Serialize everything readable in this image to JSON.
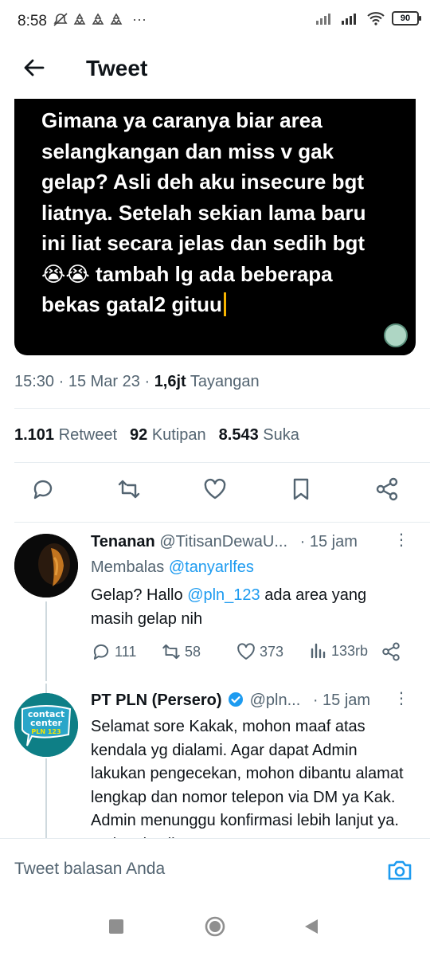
{
  "status_bar": {
    "time": "8:58",
    "battery": "90",
    "more": "···"
  },
  "header": {
    "title": "Tweet"
  },
  "tweet": {
    "image_text_lines": [
      "Gimana ya caranya biar area",
      "selangkangan dan miss v gak",
      "gelap? Asli deh aku insecure bgt",
      "liatnya. Setelah sekian lama baru",
      "ini liat secara jelas dan sedih bgt",
      "😭😭 tambah lg ada beberapa",
      "bekas gatal2 gituu"
    ],
    "time": "15:30",
    "date": "15 Mar 23",
    "views_count": "1,6jt",
    "views_label": "Tayangan",
    "retweets_count": "1.101",
    "retweets_label": "Retweet",
    "quotes_count": "92",
    "quotes_label": "Kutipan",
    "likes_count": "8.543",
    "likes_label": "Suka"
  },
  "replies": [
    {
      "name": "Tenanan",
      "handle": "@TitisanDewaU...",
      "time": "· 15 jam",
      "replying_prefix": "Membalas",
      "replying_to": "@tanyarlfes",
      "text_a": "Gelap? Hallo ",
      "mention": "@pln_123",
      "text_b": " ada area yang masih gelap nih",
      "reply_count": "111",
      "retweet_count": "58",
      "like_count": "373",
      "view_count": "133rb"
    },
    {
      "name": "PT PLN (Persero)",
      "handle": "@pln...",
      "time": "· 15 jam",
      "avatar_line1": "contact",
      "avatar_line2": "center",
      "avatar_line3": "PLN 123",
      "text": "Selamat sore Kakak, mohon maaf atas kendala yg dialami. Agar dapat Admin lakukan pengecekan, mohon dibantu alamat lengkap dan nomor telepon via DM ya Kak. Admin menunggu konfirmasi lebih lanjut ya. Terima kasih"
    }
  ],
  "reply_box": {
    "placeholder": "Tweet balasan Anda"
  },
  "colors": {
    "accent": "#1d9bf0",
    "text_secondary": "#536471"
  }
}
